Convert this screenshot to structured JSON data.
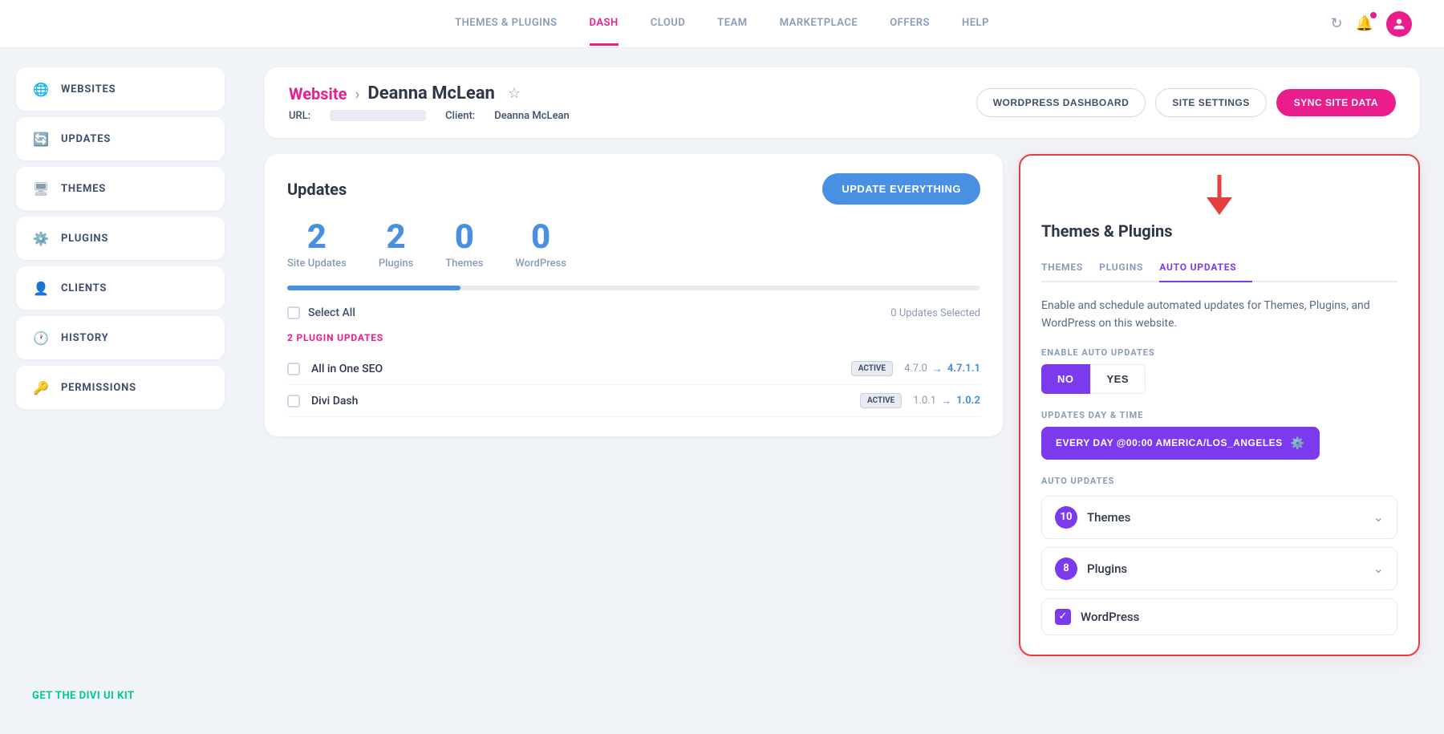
{
  "nav": {
    "links": [
      {
        "id": "themes-plugins",
        "label": "THEMES & PLUGINS",
        "active": false
      },
      {
        "id": "dash",
        "label": "DASH",
        "active": true
      },
      {
        "id": "cloud",
        "label": "CLOUD",
        "active": false
      },
      {
        "id": "team",
        "label": "TEAM",
        "active": false
      },
      {
        "id": "marketplace",
        "label": "MARKETPLACE",
        "active": false
      },
      {
        "id": "offers",
        "label": "OFFERS",
        "active": false
      },
      {
        "id": "help",
        "label": "HELP",
        "active": false
      }
    ]
  },
  "sidebar": {
    "items": [
      {
        "id": "websites",
        "label": "WEBSITES",
        "icon": "globe"
      },
      {
        "id": "updates",
        "label": "UPDATES",
        "icon": "refresh"
      },
      {
        "id": "themes",
        "label": "THEMES",
        "icon": "monitor"
      },
      {
        "id": "plugins",
        "label": "PLUGINS",
        "icon": "gear"
      },
      {
        "id": "clients",
        "label": "CLIENTS",
        "icon": "user"
      },
      {
        "id": "history",
        "label": "HISTORY",
        "icon": "clock"
      },
      {
        "id": "permissions",
        "label": "PERMISSIONS",
        "icon": "key"
      }
    ],
    "kit_link": "GET THE DIVI UI KIT"
  },
  "header": {
    "breadcrumb_link": "Website",
    "separator": ">",
    "site_name": "Deanna McLean",
    "url_label": "URL:",
    "client_label": "Client:",
    "client_name": "Deanna McLean",
    "btn_wordpress": "WORDPRESS DASHBOARD",
    "btn_settings": "SITE SETTINGS",
    "btn_sync": "SYNC SITE DATA"
  },
  "updates": {
    "title": "Updates",
    "btn_label": "UPDATE EVERYTHING",
    "stats": [
      {
        "number": "2",
        "label": "Site Updates"
      },
      {
        "number": "2",
        "label": "Plugins"
      },
      {
        "number": "0",
        "label": "Themes"
      },
      {
        "number": "0",
        "label": "WordPress"
      }
    ],
    "select_all": "Select All",
    "updates_selected": "0 Updates Selected",
    "plugin_updates_label": "2 PLUGIN UPDATES",
    "plugins": [
      {
        "name": "All in One SEO",
        "badge": "ACTIVE",
        "from": "4.7.0",
        "to": "4.7.1.1"
      },
      {
        "name": "Divi Dash",
        "badge": "ACTIVE",
        "from": "1.0.1",
        "to": "1.0.2"
      }
    ]
  },
  "right_panel": {
    "title": "Themes & Plugins",
    "tabs": [
      {
        "id": "themes",
        "label": "THEMES"
      },
      {
        "id": "plugins",
        "label": "PLUGINS"
      },
      {
        "id": "auto-updates",
        "label": "AUTO UPDATES",
        "active": true
      }
    ],
    "description": "Enable and schedule automated updates for Themes, Plugins, and WordPress on this website.",
    "enable_label": "ENABLE AUTO UPDATES",
    "toggle_no": "NO",
    "toggle_yes": "YES",
    "schedule_label": "UPDATES DAY & TIME",
    "schedule_value": "EVERY DAY @00:00 AMERICA/LOS_ANGELES",
    "auto_updates_label": "AUTO UPDATES",
    "items": [
      {
        "id": "themes",
        "count": "10",
        "label": "Themes"
      },
      {
        "id": "plugins",
        "count": "8",
        "label": "Plugins"
      }
    ],
    "wordpress_label": "WordPress"
  }
}
